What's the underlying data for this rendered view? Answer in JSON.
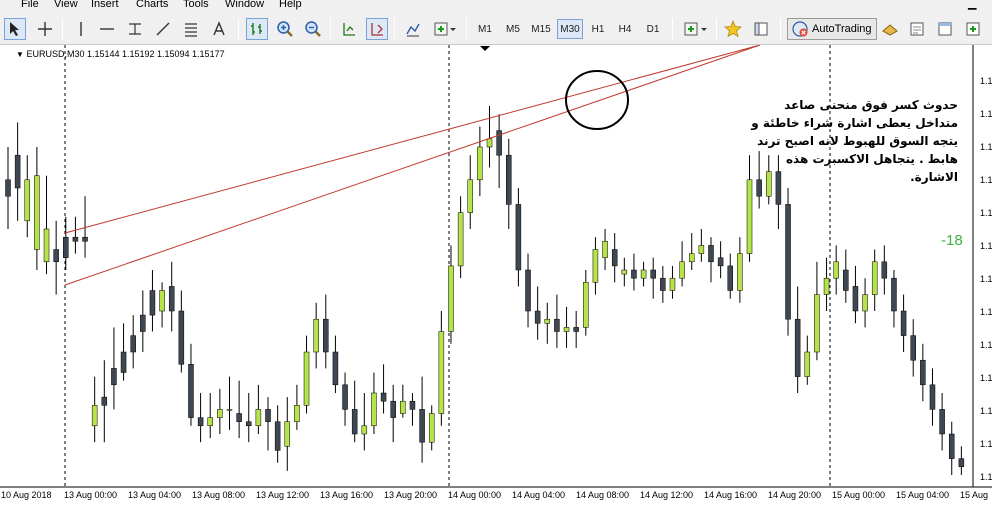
{
  "menu": [
    "File",
    "View",
    "Insert",
    "Charts",
    "Tools",
    "Window",
    "Help"
  ],
  "toolbar": {
    "timeframes": [
      "M1",
      "M5",
      "M15",
      "M30",
      "H1",
      "H4",
      "D1"
    ],
    "active_timeframe": "M30",
    "autotrading_label": "AutoTrading"
  },
  "chart": {
    "symbol_info": "EURUSD,M30  1.15144 1.15192 1.15094 1.15177",
    "annotation_lines": [
      "حدوث كسر فوق منحنى صاعد",
      "متداخل يعطى اشارة شراء خاطئة و",
      "يتجه السوق للهبوط لانه اصبح ترند",
      "هابط . يتجاهل الاكسبرت هذه",
      "الاشارة."
    ],
    "indicator_value": "-18",
    "price_axis_labels": [
      "1.1",
      "1.1",
      "1.1",
      "1.1",
      "1.1",
      "1.1",
      "1.1",
      "1.1",
      "1.1",
      "1.1",
      "1.1",
      "1.1",
      "1.1"
    ],
    "time_axis_labels": [
      "10 Aug 2018",
      "13 Aug 00:00",
      "13 Aug 04:00",
      "13 Aug 08:00",
      "13 Aug 12:00",
      "13 Aug 16:00",
      "13 Aug 20:00",
      "14 Aug 00:00",
      "14 Aug 04:00",
      "14 Aug 08:00",
      "14 Aug 12:00",
      "14 Aug 16:00",
      "14 Aug 20:00",
      "15 Aug 00:00",
      "15 Aug 04:00",
      "15 Aug"
    ],
    "bull_color": "#b6e34a",
    "bear_color": "#3f4753",
    "trendline_color": "#c0392b"
  },
  "chart_data": {
    "type": "candlestick",
    "symbol": "EURUSD",
    "timeframe": "M30",
    "ohlc_relative": [
      [
        0.72,
        0.68,
        0.8,
        0.6
      ],
      [
        0.78,
        0.7,
        0.86,
        0.62
      ],
      [
        0.62,
        0.72,
        0.78,
        0.58
      ],
      [
        0.55,
        0.73,
        0.8,
        0.5
      ],
      [
        0.52,
        0.6,
        0.73,
        0.49
      ],
      [
        0.55,
        0.52,
        0.62,
        0.44
      ],
      [
        0.58,
        0.53,
        0.63,
        0.5
      ],
      [
        0.58,
        0.57,
        0.63,
        0.54
      ],
      [
        0.58,
        0.57,
        0.68,
        0.53
      ],
      [
        0.12,
        0.17,
        0.24,
        0.08
      ],
      [
        0.19,
        0.17,
        0.28,
        0.08
      ],
      [
        0.26,
        0.22,
        0.36,
        0.16
      ],
      [
        0.3,
        0.25,
        0.37,
        0.23
      ],
      [
        0.34,
        0.3,
        0.39,
        0.26
      ],
      [
        0.39,
        0.35,
        0.45,
        0.3
      ],
      [
        0.45,
        0.39,
        0.5,
        0.35
      ],
      [
        0.4,
        0.45,
        0.47,
        0.36
      ],
      [
        0.46,
        0.4,
        0.52,
        0.35
      ],
      [
        0.4,
        0.27,
        0.45,
        0.25
      ],
      [
        0.27,
        0.14,
        0.32,
        0.12
      ],
      [
        0.14,
        0.12,
        0.2,
        0.08
      ],
      [
        0.12,
        0.14,
        0.2,
        0.09
      ],
      [
        0.14,
        0.16,
        0.21,
        0.1
      ],
      [
        0.16,
        0.16,
        0.24,
        0.11
      ],
      [
        0.15,
        0.13,
        0.23,
        0.09
      ],
      [
        0.13,
        0.12,
        0.2,
        0.08
      ],
      [
        0.12,
        0.16,
        0.22,
        0.1
      ],
      [
        0.16,
        0.13,
        0.19,
        0.06
      ],
      [
        0.13,
        0.06,
        0.17,
        0.03
      ],
      [
        0.07,
        0.13,
        0.19,
        0.01
      ],
      [
        0.13,
        0.17,
        0.22,
        0.11
      ],
      [
        0.17,
        0.3,
        0.34,
        0.15
      ],
      [
        0.3,
        0.38,
        0.42,
        0.26
      ],
      [
        0.38,
        0.3,
        0.44,
        0.26
      ],
      [
        0.3,
        0.22,
        0.34,
        0.2
      ],
      [
        0.22,
        0.16,
        0.25,
        0.12
      ],
      [
        0.16,
        0.1,
        0.23,
        0.08
      ],
      [
        0.1,
        0.12,
        0.2,
        0.06
      ],
      [
        0.12,
        0.2,
        0.25,
        0.1
      ],
      [
        0.2,
        0.18,
        0.27,
        0.15
      ],
      [
        0.18,
        0.14,
        0.22,
        0.08
      ],
      [
        0.15,
        0.18,
        0.22,
        0.14
      ],
      [
        0.18,
        0.16,
        0.2,
        0.12
      ],
      [
        0.16,
        0.08,
        0.24,
        0.03
      ],
      [
        0.08,
        0.15,
        0.17,
        0.06
      ],
      [
        0.15,
        0.35,
        0.4,
        0.12
      ],
      [
        0.35,
        0.51,
        0.56,
        0.32
      ],
      [
        0.51,
        0.64,
        0.68,
        0.48
      ],
      [
        0.64,
        0.72,
        0.78,
        0.6
      ],
      [
        0.72,
        0.8,
        0.85,
        0.68
      ],
      [
        0.8,
        0.82,
        0.9,
        0.75
      ],
      [
        0.84,
        0.78,
        0.88,
        0.7
      ],
      [
        0.78,
        0.66,
        0.82,
        0.6
      ],
      [
        0.66,
        0.5,
        0.7,
        0.46
      ],
      [
        0.5,
        0.4,
        0.54,
        0.36
      ],
      [
        0.4,
        0.37,
        0.46,
        0.33
      ],
      [
        0.37,
        0.38,
        0.42,
        0.32
      ],
      [
        0.38,
        0.35,
        0.44,
        0.31
      ],
      [
        0.35,
        0.36,
        0.41,
        0.31
      ],
      [
        0.36,
        0.35,
        0.4,
        0.31
      ],
      [
        0.36,
        0.47,
        0.5,
        0.34
      ],
      [
        0.47,
        0.55,
        0.58,
        0.44
      ],
      [
        0.53,
        0.57,
        0.6,
        0.5
      ],
      [
        0.55,
        0.51,
        0.59,
        0.47
      ],
      [
        0.49,
        0.5,
        0.53,
        0.46
      ],
      [
        0.5,
        0.48,
        0.54,
        0.45
      ],
      [
        0.48,
        0.5,
        0.52,
        0.46
      ],
      [
        0.5,
        0.48,
        0.53,
        0.43
      ],
      [
        0.48,
        0.45,
        0.51,
        0.42
      ],
      [
        0.45,
        0.48,
        0.51,
        0.43
      ],
      [
        0.48,
        0.52,
        0.57,
        0.46
      ],
      [
        0.52,
        0.54,
        0.59,
        0.5
      ],
      [
        0.54,
        0.56,
        0.6,
        0.52
      ],
      [
        0.56,
        0.52,
        0.58,
        0.47
      ],
      [
        0.53,
        0.51,
        0.57,
        0.48
      ],
      [
        0.51,
        0.45,
        0.54,
        0.43
      ],
      [
        0.45,
        0.54,
        0.58,
        0.42
      ],
      [
        0.54,
        0.72,
        0.78,
        0.52
      ],
      [
        0.72,
        0.68,
        0.79,
        0.65
      ],
      [
        0.68,
        0.74,
        0.78,
        0.66
      ],
      [
        0.74,
        0.66,
        0.78,
        0.6
      ],
      [
        0.66,
        0.38,
        0.7,
        0.34
      ],
      [
        0.38,
        0.24,
        0.46,
        0.2
      ],
      [
        0.24,
        0.3,
        0.34,
        0.22
      ],
      [
        0.3,
        0.44,
        0.52,
        0.28
      ],
      [
        0.44,
        0.48,
        0.53,
        0.4
      ],
      [
        0.48,
        0.52,
        0.56,
        0.44
      ],
      [
        0.5,
        0.45,
        0.55,
        0.42
      ],
      [
        0.46,
        0.4,
        0.51,
        0.37
      ],
      [
        0.4,
        0.44,
        0.48,
        0.36
      ],
      [
        0.44,
        0.52,
        0.55,
        0.4
      ],
      [
        0.52,
        0.48,
        0.56,
        0.44
      ],
      [
        0.48,
        0.4,
        0.5,
        0.36
      ],
      [
        0.4,
        0.34,
        0.44,
        0.3
      ],
      [
        0.34,
        0.28,
        0.38,
        0.24
      ],
      [
        0.28,
        0.22,
        0.32,
        0.18
      ],
      [
        0.22,
        0.16,
        0.26,
        0.12
      ],
      [
        0.16,
        0.1,
        0.2,
        0.06
      ],
      [
        0.1,
        0.04,
        0.13,
        0.0
      ],
      [
        0.04,
        0.02,
        0.07,
        0.0
      ]
    ]
  }
}
